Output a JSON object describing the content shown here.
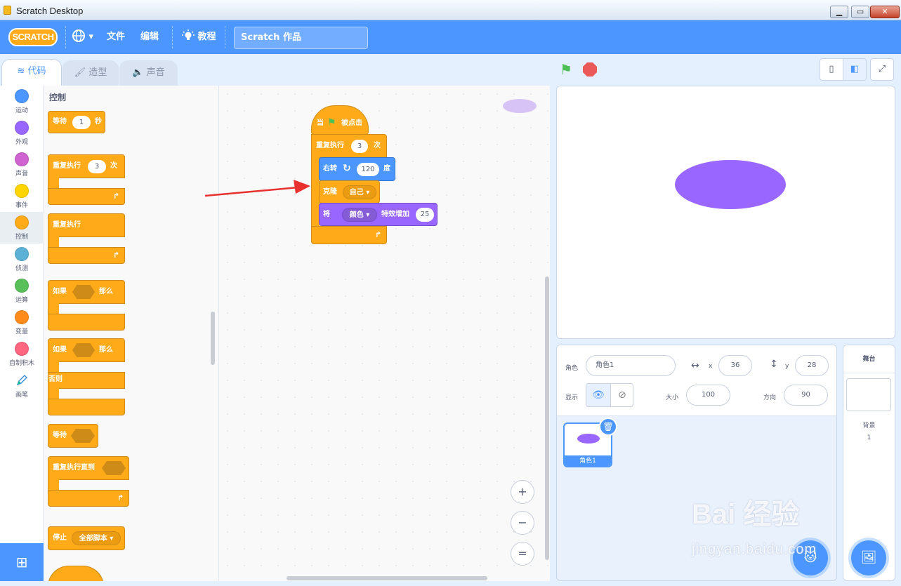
{
  "window": {
    "title": "Scratch Desktop",
    "minimize_glyph": "▁",
    "restore_glyph": "▭",
    "close_glyph": "✕"
  },
  "menubar": {
    "logo_text": "SCRATCH",
    "language_icon": "globe-icon",
    "language_caret": "▾",
    "file": "文件",
    "edit": "编辑",
    "tutorials_icon": "lightbulb-icon",
    "tutorials": "教程",
    "project_title": "Scratch 作品"
  },
  "tabs": [
    {
      "label": "代码",
      "icon": "code-icon",
      "glyph": "≋",
      "active": true
    },
    {
      "label": "造型",
      "icon": "brush-icon",
      "glyph": "🖌",
      "active": false
    },
    {
      "label": "声音",
      "icon": "speaker-icon",
      "glyph": "🔈",
      "active": false
    }
  ],
  "categories": [
    {
      "label": "运动",
      "color": "#4c97ff"
    },
    {
      "label": "外观",
      "color": "#9966ff"
    },
    {
      "label": "声音",
      "color": "#cf63cf"
    },
    {
      "label": "事件",
      "color": "#ffd500"
    },
    {
      "label": "控制",
      "color": "#ffab19",
      "active": true
    },
    {
      "label": "侦测",
      "color": "#5cb1d6"
    },
    {
      "label": "运算",
      "color": "#59c059"
    },
    {
      "label": "变量",
      "color": "#ff8c1a"
    },
    {
      "label": "自制积木",
      "color": "#ff6680"
    },
    {
      "label": "画笔",
      "color": "#0fbd8c",
      "icon": "pen-icon"
    }
  ],
  "extension_button_glyph": "⊞",
  "palette": {
    "title": "控制",
    "wait": {
      "label": "等待",
      "value": "1",
      "unit": "秒"
    },
    "repeat": {
      "label": "重复执行",
      "value": "3",
      "unit": "次"
    },
    "forever": {
      "label": "重复执行"
    },
    "if_then": {
      "label": "如果",
      "then": "那么"
    },
    "if_else": {
      "label": "如果",
      "then": "那么",
      "else": "否则"
    },
    "wait_until": {
      "label": "等待"
    },
    "repeat_until": {
      "label": "重复执行直到"
    },
    "stop": {
      "label": "停止",
      "option": "全部脚本"
    },
    "loop_arrow": "↱"
  },
  "script": {
    "hat": {
      "prefix": "当",
      "flag": "⚑",
      "suffix": "被点击"
    },
    "repeat": {
      "label": "重复执行",
      "value": "3",
      "unit": "次"
    },
    "turn": {
      "label": "右转",
      "icon": "rotate-right-icon",
      "glyph": "↻",
      "value": "120",
      "unit": "度"
    },
    "clone": {
      "label": "克隆",
      "option": "自己"
    },
    "effect": {
      "label": "将",
      "option": "颜色",
      "middle": "特效增加",
      "value": "25"
    },
    "loop_arrow": "↱"
  },
  "zoom": {
    "in": "+",
    "out": "−",
    "reset": "="
  },
  "stage_controls": {
    "flag_glyph": "⚑",
    "small_stage_glyph": "▯",
    "large_stage_glyph": "◧",
    "fullscreen_glyph": "⤢"
  },
  "sprite_info": {
    "sprite_label": "角色",
    "sprite_name": "角色1",
    "x_label": "x",
    "x": "36",
    "y_label": "y",
    "y": "28",
    "show_label": "显示",
    "show_on_glyph": "👁",
    "show_off_glyph": "⊘",
    "size_label": "大小",
    "size": "100",
    "direction_label": "方向",
    "direction": "90",
    "x_arrow": "↔",
    "y_arrow": "↕"
  },
  "sprites": [
    {
      "name": "角色1",
      "selected": true
    }
  ],
  "delete_glyph": "🗑",
  "add_sprite_glyph": "🐱",
  "stage_pane": {
    "title": "舞台",
    "backdrops_label": "背景",
    "backdrops_count": "1"
  },
  "add_backdrop_glyph": "🖼",
  "watermark": {
    "main": "Bai 经验",
    "sub": "jingyan.baidu.com"
  },
  "colors": {
    "motion": "#4c97ff",
    "looks": "#9966ff",
    "control": "#ffab19",
    "menubar": "#4c97ff",
    "arrow": "#e8312f"
  }
}
